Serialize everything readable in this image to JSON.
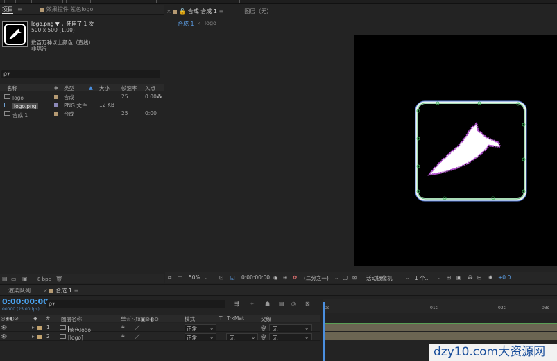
{
  "project_panel": {
    "tab_project": "项目",
    "tab_effects": "效果控件 紫色logo",
    "selected_name": "logo.png ▼ ，使用了 1 次",
    "selected_size": "500 x 500 (1.00)",
    "color_info": "数百万种以上颜色（直线）",
    "interlace": "非隔行",
    "search_placeholder": "ρ▾",
    "columns": [
      "名称",
      "类型",
      "大小",
      "帧速率",
      "入点"
    ],
    "items": [
      {
        "name": "logo",
        "type": "合成",
        "size": "",
        "fps": "25",
        "in": "0:00"
      },
      {
        "name": "logo.png",
        "type": "PNG 文件",
        "size": "12 KB",
        "fps": "",
        "in": ""
      },
      {
        "name": "合成 1",
        "type": "合成",
        "size": "",
        "fps": "25",
        "in": "0:00"
      }
    ],
    "bpc": "8 bpc"
  },
  "viewer": {
    "tab_comp": "合成 合成 1",
    "tab_layer": "图层（无）",
    "breadcrumb": [
      "合成 1",
      "logo"
    ],
    "zoom": "50%",
    "timecode": "0:00:00:00",
    "resolution": "(二分之一)",
    "camera": "活动摄像机",
    "views": "1 个...",
    "exposure": "+0.0"
  },
  "timeline": {
    "tab_render": "渲染队列",
    "tab_comp": "合成 1",
    "current_time": "0:00:00:00",
    "frame_info": "00000 (25.00 fps)",
    "search_placeholder": "ρ▾",
    "columns": {
      "num": "#",
      "name": "图层名称",
      "switches": "单☆＼fx▣⊘◐⊙",
      "mode": "模式",
      "t": "T",
      "trkmat": "TrkMat",
      "parent": "父级"
    },
    "layers": [
      {
        "num": "1",
        "name": "紫色logo",
        "mode": "正常",
        "trkmat": "",
        "parent": "无"
      },
      {
        "num": "2",
        "name": "[logo]",
        "mode": "正常",
        "trkmat": "无",
        "parent": "无"
      }
    ],
    "ruler": [
      "0s",
      "01s",
      "02s",
      "03s"
    ]
  },
  "watermark": "dzy10.com大资源网"
}
